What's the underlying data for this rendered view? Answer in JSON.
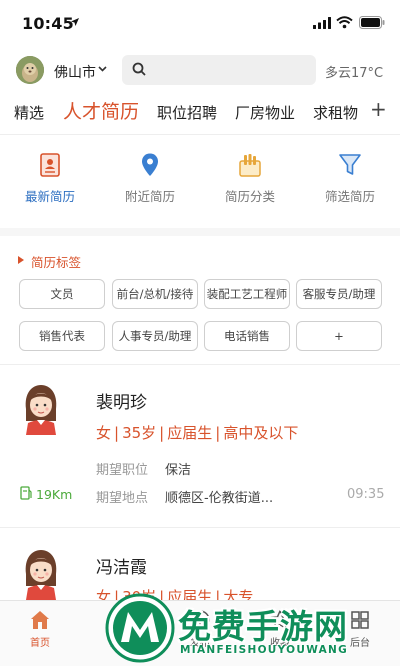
{
  "status_bar": {
    "time": "10:45"
  },
  "header": {
    "city": "佛山市",
    "search": {
      "placeholder": "",
      "value": ""
    },
    "weather": "多云17°C"
  },
  "tabs": [
    {
      "label": "精选"
    },
    {
      "label": "人才简历"
    },
    {
      "label": "职位招聘"
    },
    {
      "label": "厂房物业"
    },
    {
      "label": "求租物"
    }
  ],
  "tab_plus": "+",
  "quick": [
    {
      "label": "最新简历",
      "icon": "resume-card-icon"
    },
    {
      "label": "附近简历",
      "icon": "map-pin-icon"
    },
    {
      "label": "简历分类",
      "icon": "category-icon"
    },
    {
      "label": "筛选简历",
      "icon": "filter-funnel-icon"
    }
  ],
  "tags_title": "简历标签",
  "tags": [
    "文员",
    "前台/总机/接待",
    "装配工艺工程师",
    "客服专员/助理",
    "销售代表",
    "人事专员/助理",
    "电话销售",
    "+"
  ],
  "resumes": [
    {
      "name": "裴明珍",
      "gender": "女",
      "age": "35岁",
      "experience": "应届生",
      "education": "高中及以下",
      "position_label": "期望职位",
      "position": "保洁",
      "location_label": "期望地点",
      "location": "顺德区-伦教街道...",
      "distance": "19Km",
      "time": "09:35"
    },
    {
      "name": "冯洁霞",
      "gender": "女",
      "age": "30岁",
      "experience": "应届生",
      "education": "大专"
    }
  ],
  "bottom_nav": [
    {
      "label": "首页",
      "icon": "home-icon"
    },
    {
      "label": "好店",
      "icon": "shop-icon"
    },
    {
      "label": "发布",
      "icon": "publish-icon"
    },
    {
      "label": "收藏",
      "icon": "star-icon"
    },
    {
      "label": "后台",
      "icon": "dashboard-icon"
    }
  ],
  "watermark": {
    "title": "免费手游网",
    "subtitle": "MIANFEISHOUYOUWANG"
  },
  "colors": {
    "accent": "#d8532c",
    "blue": "#2d6fc1",
    "green": "#4caa3c",
    "watermark": "#0f8e5a"
  }
}
